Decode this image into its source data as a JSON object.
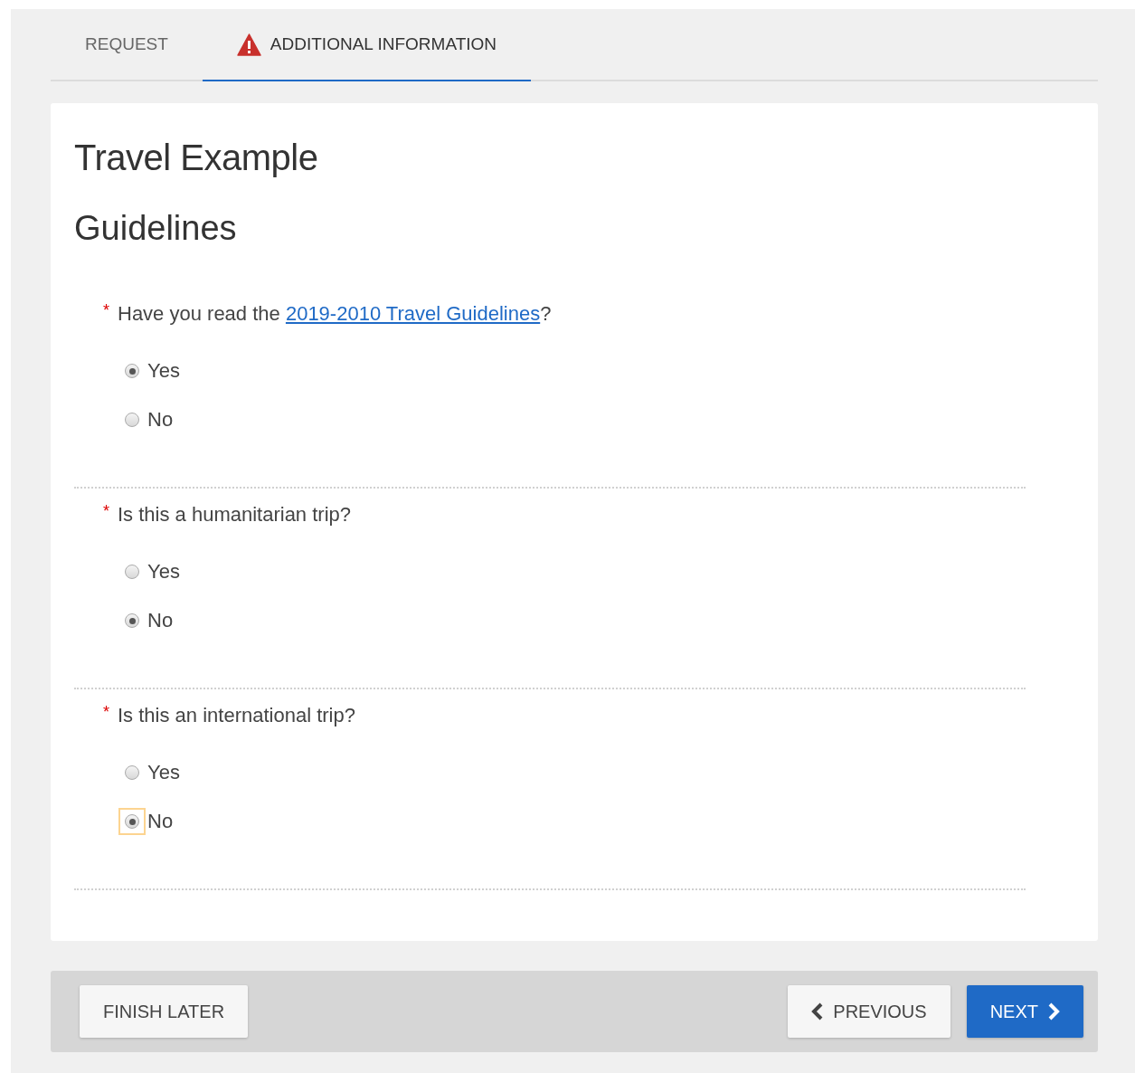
{
  "tabs": [
    {
      "label": "REQUEST",
      "selected": false,
      "warning": false
    },
    {
      "label": "ADDITIONAL INFORMATION",
      "selected": true,
      "warning": true
    }
  ],
  "form": {
    "title": "Travel Example",
    "section": "Guidelines",
    "questions": [
      {
        "marker": "*",
        "text": "Have you read the ",
        "link": "2019-2010 Travel Guidelines",
        "text_after": "?",
        "options": [
          {
            "label": "Yes",
            "selected": true,
            "focused": false
          },
          {
            "label": "No",
            "selected": false,
            "focused": false
          }
        ]
      },
      {
        "marker": "*",
        "text": "Is this a humanitarian trip?",
        "options": [
          {
            "label": "Yes",
            "selected": false,
            "focused": false
          },
          {
            "label": "No",
            "selected": true,
            "focused": false
          }
        ]
      },
      {
        "marker": "*",
        "text": "Is this an international trip?",
        "options": [
          {
            "label": "Yes",
            "selected": false,
            "focused": false
          },
          {
            "label": "No",
            "selected": true,
            "focused": true
          }
        ]
      }
    ]
  },
  "footer": {
    "finish_later": "FINISH LATER",
    "previous": "PREVIOUS",
    "next": "NEXT"
  }
}
